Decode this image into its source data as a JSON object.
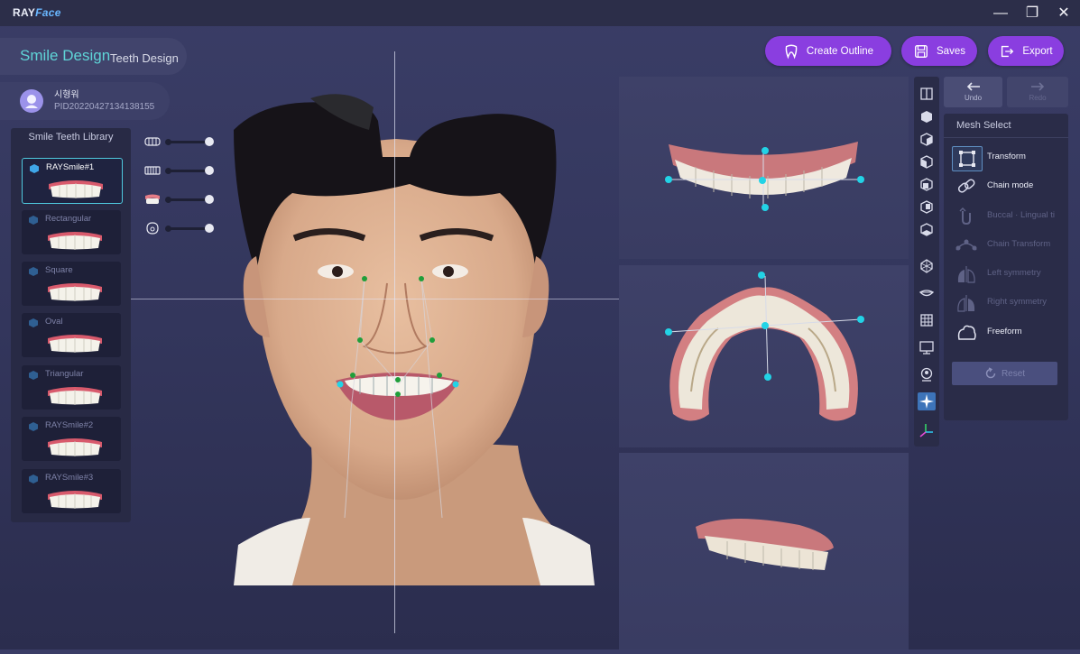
{
  "app": {
    "logo_main": "RAY",
    "logo_accent": "Face"
  },
  "window": {
    "min": "—",
    "max": "❐",
    "close": "✕"
  },
  "mode": {
    "primary": "Smile Design",
    "secondary": "Teeth Design"
  },
  "patient": {
    "name": "시형워",
    "id": "PID20220427134138155"
  },
  "actions": {
    "create_outline": "Create Outline",
    "saves": "Saves",
    "export": "Export"
  },
  "library": {
    "title": "Smile Teeth Library",
    "items": [
      {
        "label": "RAYSmile#1",
        "active": true
      },
      {
        "label": "Rectangular"
      },
      {
        "label": "Square"
      },
      {
        "label": "Oval"
      },
      {
        "label": "Triangular"
      },
      {
        "label": "RAYSmile#2"
      },
      {
        "label": "RAYSmile#3"
      }
    ]
  },
  "history": {
    "undo": "Undo",
    "redo": "Redo"
  },
  "mesh_select": {
    "title": "Mesh Select",
    "items": [
      {
        "label": "Transform",
        "enabled": true
      },
      {
        "label": "Chain mode",
        "enabled": true
      },
      {
        "label": "Buccal · Lingual ti",
        "enabled": false
      },
      {
        "label": "Chain Transform",
        "enabled": false
      },
      {
        "label": "Left symmetry",
        "enabled": false
      },
      {
        "label": "Right symmetry",
        "enabled": false
      },
      {
        "label": "Freeform",
        "enabled": true
      }
    ],
    "reset": "Reset"
  },
  "colors": {
    "accent_purple": "#8a3ee0",
    "accent_cyan": "#5fd4d7",
    "handle_cyan": "#22d3e6",
    "landmark_green": "#1f9e3a"
  }
}
